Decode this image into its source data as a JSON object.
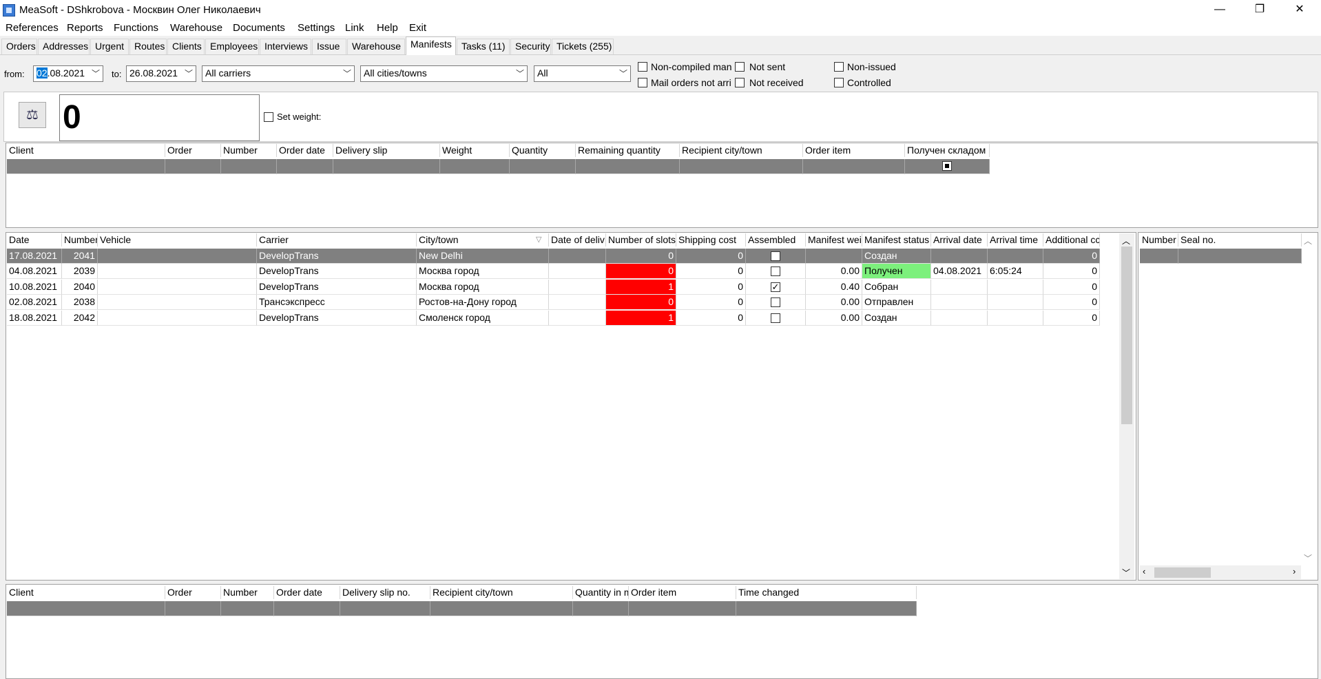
{
  "window": {
    "title": "MeaSoft - DShkrobova - Москвин Олег Николаевич",
    "minimize_glyph": "—",
    "restore_glyph": "❐",
    "close_glyph": "✕"
  },
  "menu": [
    "References",
    "Reports",
    "Functions",
    "Warehouse",
    "Documents",
    "Settings",
    "Link",
    "Help",
    "Exit"
  ],
  "tabs": [
    {
      "label": "Orders"
    },
    {
      "label": "Addresses"
    },
    {
      "label": "Urgent"
    },
    {
      "label": "Routes"
    },
    {
      "label": "Clients"
    },
    {
      "label": "Employees"
    },
    {
      "label": "Interviews"
    },
    {
      "label": "Issue"
    },
    {
      "label": "Warehouse"
    },
    {
      "label": "Manifests",
      "active": true
    },
    {
      "label": "Tasks (11)"
    },
    {
      "label": "Security"
    },
    {
      "label": "Tickets (255)"
    }
  ],
  "filters": {
    "from_label": "from:",
    "from_value_day": "02",
    "from_value_rest": ".08.2021",
    "to_label": "to:",
    "to_value": "26.08.2021",
    "carrier": "All carriers",
    "city": "All cities/towns",
    "status": "All",
    "checkboxes": {
      "non_compiled": "Non-compiled manif",
      "mail_not_arrived": "Mail orders not arriv",
      "not_sent": "Not sent",
      "not_received": "Not received",
      "non_issued": "Non-issued",
      "controlled": "Controlled"
    }
  },
  "weight": {
    "value": "0",
    "set_weight_label": "Set weight:",
    "scale_icon": "⚖"
  },
  "top_grid": {
    "columns": [
      "Client",
      "Order",
      "Number",
      "Order date",
      "Delivery slip",
      "Weight",
      "Quantity",
      "Remaining quantity",
      "Recipient city/town",
      "Order item",
      "Получен складом"
    ]
  },
  "manifest_grid": {
    "columns": [
      "Date",
      "Number",
      "Vehicle",
      "Carrier",
      "City/town",
      "Date of deliv",
      "Number of slots",
      "Shipping cost",
      "Assembled",
      "Manifest wei",
      "Manifest status",
      "Arrival date",
      "Arrival time",
      "Additional cc"
    ],
    "sort_icon": "▽",
    "rows": [
      {
        "date": "17.08.2021",
        "number": "2041",
        "vehicle": "",
        "carrier": "DevelopTrans",
        "city": "New Delhi",
        "delivery_date": "",
        "slots": "0",
        "shipping": "0",
        "assembled": false,
        "weight": "",
        "status": "Создан",
        "arrival_date": "",
        "arrival_time": "",
        "additional": "0",
        "slots_alert": false,
        "status_ok": false
      },
      {
        "date": "04.08.2021",
        "number": "2039",
        "vehicle": "",
        "carrier": "DevelopTrans",
        "city": "Москва город",
        "delivery_date": "",
        "slots": "0",
        "shipping": "0",
        "assembled": false,
        "weight": "0.00",
        "status": "Получен",
        "arrival_date": "04.08.2021",
        "arrival_time": "6:05:24",
        "additional": "0",
        "slots_alert": true,
        "status_ok": true
      },
      {
        "date": "10.08.2021",
        "number": "2040",
        "vehicle": "",
        "carrier": "DevelopTrans",
        "city": "Москва город",
        "delivery_date": "",
        "slots": "1",
        "shipping": "0",
        "assembled": true,
        "weight": "0.40",
        "status": "Собран",
        "arrival_date": "",
        "arrival_time": "",
        "additional": "0",
        "slots_alert": true,
        "status_ok": false
      },
      {
        "date": "02.08.2021",
        "number": "2038",
        "vehicle": "",
        "carrier": "Трансэкспресс",
        "city": "Ростов-на-Дону город",
        "delivery_date": "",
        "slots": "0",
        "shipping": "0",
        "assembled": false,
        "weight": "0.00",
        "status": "Отправлен",
        "arrival_date": "",
        "arrival_time": "",
        "additional": "0",
        "slots_alert": true,
        "status_ok": false
      },
      {
        "date": "18.08.2021",
        "number": "2042",
        "vehicle": "",
        "carrier": "DevelopTrans",
        "city": "Смоленск город",
        "delivery_date": "",
        "slots": "1",
        "shipping": "0",
        "assembled": false,
        "weight": "0.00",
        "status": "Создан",
        "arrival_date": "",
        "arrival_time": "",
        "additional": "0",
        "slots_alert": true,
        "status_ok": false
      }
    ]
  },
  "seal_grid": {
    "columns": [
      "Number",
      "Seal no."
    ]
  },
  "bottom_grid": {
    "columns": [
      "Client",
      "Order",
      "Number",
      "Order date",
      "Delivery slip no.",
      "Recipient city/town",
      "Quantity in m",
      "Order item",
      "Time changed"
    ]
  },
  "colors": {
    "alert_red": "#ff0000",
    "ok_green": "#7cf07c",
    "selected_row": "#808080"
  }
}
